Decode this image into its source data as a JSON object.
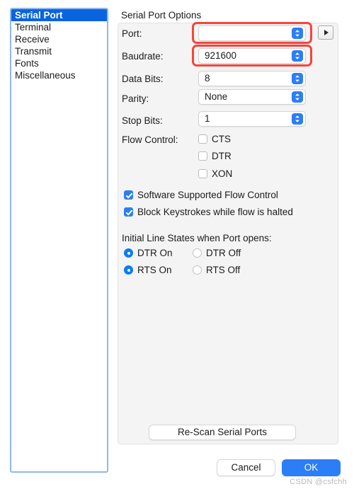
{
  "window": {
    "title": "Serial Port Options"
  },
  "sidebar": {
    "items": [
      {
        "label": "Serial Port",
        "selected": true
      },
      {
        "label": "Terminal",
        "selected": false
      },
      {
        "label": "Receive",
        "selected": false
      },
      {
        "label": "Transmit",
        "selected": false
      },
      {
        "label": "Fonts",
        "selected": false
      },
      {
        "label": "Miscellaneous",
        "selected": false
      }
    ]
  },
  "options": {
    "port": {
      "label": "Port:",
      "value": ""
    },
    "baudrate": {
      "label": "Baudrate:",
      "value": "921600"
    },
    "data_bits": {
      "label": "Data Bits:",
      "value": "8"
    },
    "parity": {
      "label": "Parity:",
      "value": "None"
    },
    "stop_bits": {
      "label": "Stop Bits:",
      "value": "1"
    }
  },
  "flow_control": {
    "label": "Flow Control:",
    "items": [
      {
        "label": "CTS",
        "checked": false
      },
      {
        "label": "DTR",
        "checked": false
      },
      {
        "label": "XON",
        "checked": false
      }
    ]
  },
  "toggles": [
    {
      "label": "Software Supported Flow Control",
      "checked": true
    },
    {
      "label": "Block Keystrokes while flow is halted",
      "checked": true
    }
  ],
  "line_states": {
    "title": "Initial Line States when Port opens:",
    "dtr_on": {
      "label": "DTR On",
      "selected": true
    },
    "dtr_off": {
      "label": "DTR Off",
      "selected": false
    },
    "rts_on": {
      "label": "RTS On",
      "selected": true
    },
    "rts_off": {
      "label": "RTS Off",
      "selected": false
    }
  },
  "buttons": {
    "rescan": "Re-Scan Serial Ports",
    "cancel": "Cancel",
    "ok": "OK"
  },
  "watermark": "CSDN @csfchh",
  "colors": {
    "accent": "#2b7ef5",
    "selection": "#0a64e0",
    "highlight": "#f6453c",
    "panel": "#f4f4f4"
  }
}
